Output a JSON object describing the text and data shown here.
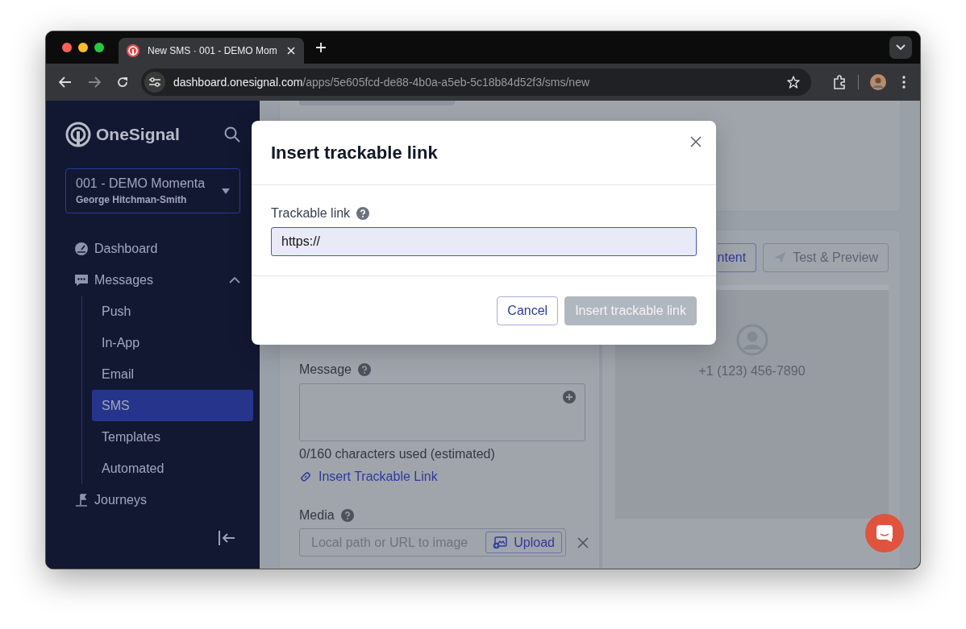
{
  "browser": {
    "tab_title": "New SMS · 001 - DEMO Mom",
    "url_host": "dashboard.onesignal.com",
    "url_path": "/apps/5e605fcd-de88-4b0a-a5eb-5c18b84d52f3/sms/new"
  },
  "sidebar": {
    "brand": "OneSignal",
    "account": {
      "name": "001 - DEMO Momenta",
      "user": "George Hitchman-Smith"
    },
    "nav": [
      {
        "label": "Dashboard"
      },
      {
        "label": "Messages",
        "expanded": true,
        "children": [
          {
            "label": "Push",
            "selected": false
          },
          {
            "label": "In-App",
            "selected": false
          },
          {
            "label": "Email",
            "selected": false
          },
          {
            "label": "SMS",
            "selected": true
          },
          {
            "label": "Templates",
            "selected": false
          },
          {
            "label": "Automated",
            "selected": false
          }
        ]
      },
      {
        "label": "Journeys"
      }
    ]
  },
  "editor": {
    "tabs": [
      {
        "label": "ntent",
        "selected": true
      },
      {
        "label": "Test & Preview",
        "selected": false
      }
    ],
    "message": {
      "label": "Message",
      "counter": "0/160 characters used (estimated)",
      "link": "Insert Trackable Link"
    },
    "media": {
      "label": "Media",
      "placeholder": "Local path or URL to image",
      "upload": "Upload"
    },
    "preview": {
      "phone": "+1 (123) 456-7890"
    }
  },
  "dialog": {
    "title": "Insert trackable link",
    "field_label": "Trackable link",
    "value": "https://",
    "buttons": [
      {
        "label": "Cancel",
        "kind": "secondary",
        "disabled": false
      },
      {
        "label": "Insert trackable link",
        "kind": "primary",
        "disabled": true
      }
    ]
  }
}
